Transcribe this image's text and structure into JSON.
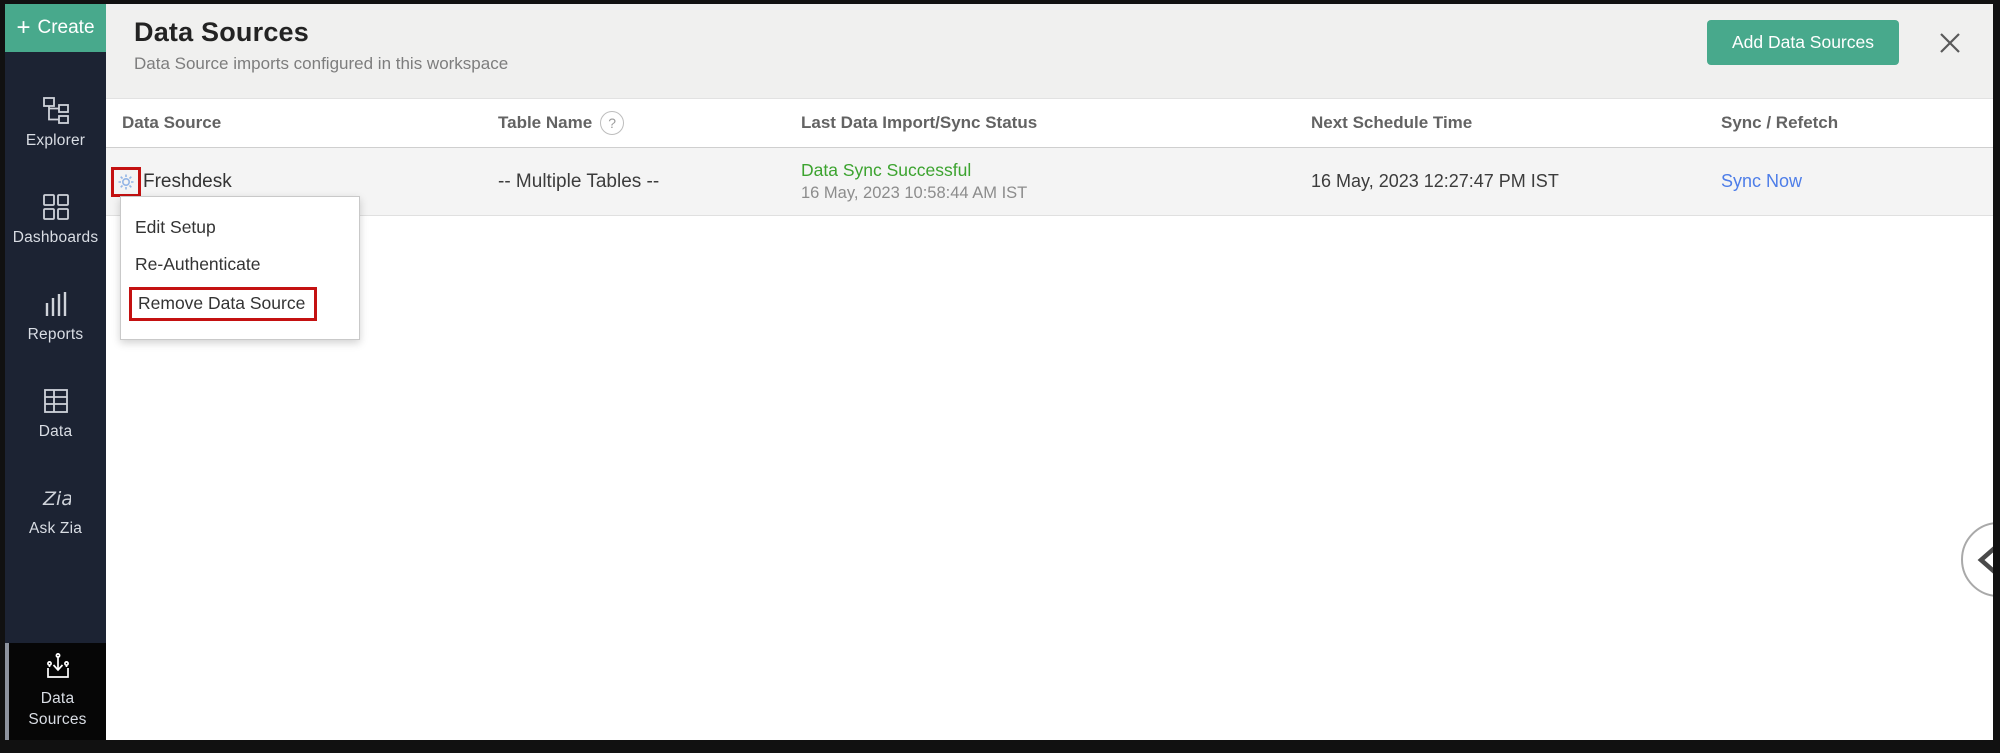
{
  "colors": {
    "teal_accent": "#48a98c",
    "sidebar_bg": "#1c2333",
    "active_item_bg": "#060606",
    "status_green": "#3ca32f",
    "link_blue": "#4d7de8",
    "annotation_red": "#c41111"
  },
  "sidebar": {
    "create_label": "Create",
    "items": [
      {
        "label": "Explorer",
        "icon": "sitemap-icon"
      },
      {
        "label": "Dashboards",
        "icon": "dashboard-grid-icon"
      },
      {
        "label": "Reports",
        "icon": "bar-chart-icon"
      },
      {
        "label": "Data",
        "icon": "table-icon"
      },
      {
        "label": "Ask Zia",
        "icon": "zia-script-icon"
      }
    ],
    "active_item": {
      "label_line1": "Data",
      "label_line2": "Sources",
      "icon": "data-import-icon"
    }
  },
  "header": {
    "title": "Data Sources",
    "subtitle": "Data Source imports configured in this workspace",
    "add_button_label": "Add Data Sources",
    "close_icon": "close-x-icon"
  },
  "table": {
    "columns": [
      "Data Source",
      "Table Name",
      "Last Data Import/Sync Status",
      "Next Schedule Time",
      "Sync / Refetch"
    ],
    "rows": [
      {
        "name": "Freshdesk",
        "table_name": "-- Multiple Tables --",
        "status": "Data Sync Successful",
        "status_time": "16 May, 2023 10:58:44 AM IST",
        "next_schedule": "16 May, 2023 12:27:47 PM IST",
        "action": "Sync Now"
      }
    ]
  },
  "context_menu": {
    "items": [
      {
        "label": "Edit Setup"
      },
      {
        "label": "Re-Authenticate"
      },
      {
        "label": "Remove Data Source",
        "highlighted": true
      }
    ]
  }
}
